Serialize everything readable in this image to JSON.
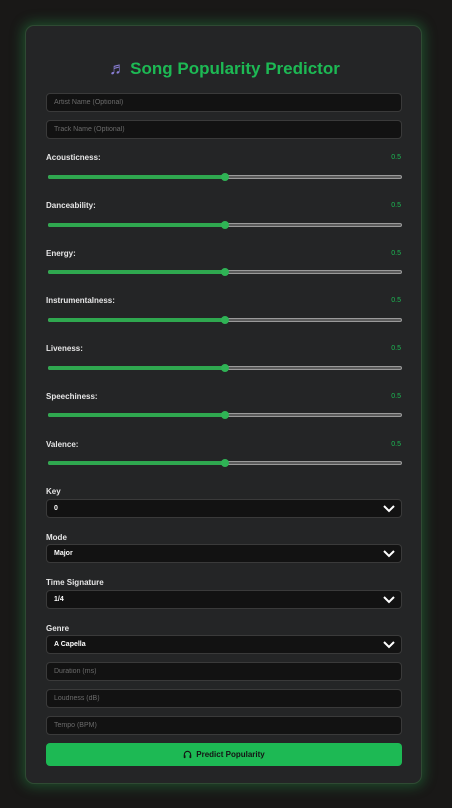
{
  "app": {
    "title": "Song Popularity Predictor",
    "title_icon": "music-note-icon"
  },
  "inputs": {
    "artist_placeholder": "Artist Name (Optional)",
    "track_placeholder": "Track Name (Optional)",
    "duration_placeholder": "Duration (ms)",
    "loudness_placeholder": "Loudness (dB)",
    "tempo_placeholder": "Tempo (BPM)"
  },
  "sliders": [
    {
      "label": "Acousticness:",
      "value": "0.5",
      "level": 0.5
    },
    {
      "label": "Danceability:",
      "value": "0.5",
      "level": 0.5
    },
    {
      "label": "Energy:",
      "value": "0.5",
      "level": 0.5
    },
    {
      "label": "Instrumentalness:",
      "value": "0.5",
      "level": 0.5
    },
    {
      "label": "Liveness:",
      "value": "0.5",
      "level": 0.5
    },
    {
      "label": "Speechiness:",
      "value": "0.5",
      "level": 0.5
    },
    {
      "label": "Valence:",
      "value": "0.5",
      "level": 0.5
    }
  ],
  "selects": {
    "key": {
      "label": "Key",
      "value": "0"
    },
    "mode": {
      "label": "Mode",
      "value": "Major"
    },
    "time_signature": {
      "label": "Time Signature",
      "value": "1/4"
    },
    "genre": {
      "label": "Genre",
      "value": "A Capella"
    }
  },
  "button": {
    "label": "Predict Popularity",
    "icon": "headphones-icon"
  },
  "colors": {
    "accent": "#1db954",
    "background": "#191817",
    "card": "#242526",
    "input_bg": "#121212"
  }
}
